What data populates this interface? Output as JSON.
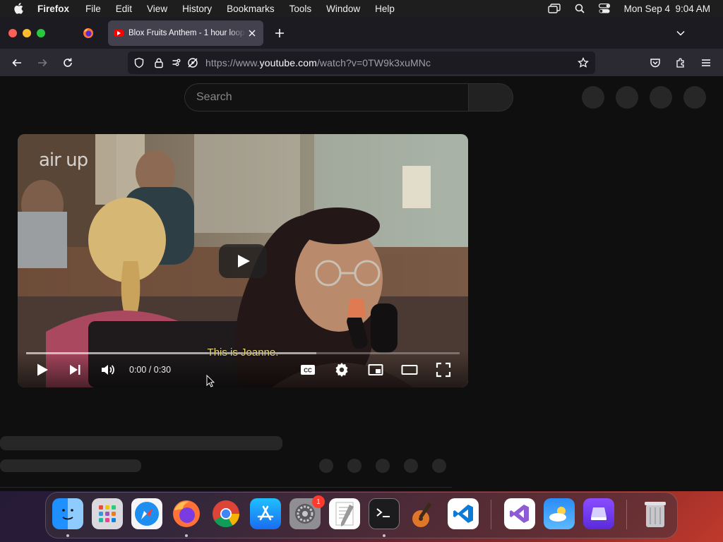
{
  "menubar": {
    "app_name": "Firefox",
    "items": [
      "File",
      "Edit",
      "View",
      "History",
      "Bookmarks",
      "Tools",
      "Window",
      "Help"
    ],
    "clock": "Mon Sep 4  9:04 AM"
  },
  "browser": {
    "active_tab_title": "Blox Fruits Anthem - 1 hour loop",
    "url_prefix": "https://www.",
    "url_domain": "youtube.com",
    "url_path": "/watch?v=0TW9k3xuMNc"
  },
  "youtube": {
    "search_placeholder": "Search",
    "video": {
      "brand_logo": "air up",
      "caption": "This is Joanne.",
      "time": "0:00 / 0:30",
      "progress_loaded": 0.67,
      "cc_label": "CC"
    }
  },
  "dock": {
    "settings_badge": "1",
    "apps": [
      "Finder",
      "Launchpad",
      "Safari",
      "Firefox",
      "Chrome",
      "App Store",
      "System Settings",
      "TextEdit",
      "Terminal",
      "GarageBand",
      "Visual Studio Code",
      "Visual Studio",
      "Weather",
      "Simulator",
      "Trash"
    ]
  },
  "colors": {
    "youtube_red": "#ff0000",
    "caption": "#e7d77a",
    "page_bg": "#0f0f0f"
  }
}
